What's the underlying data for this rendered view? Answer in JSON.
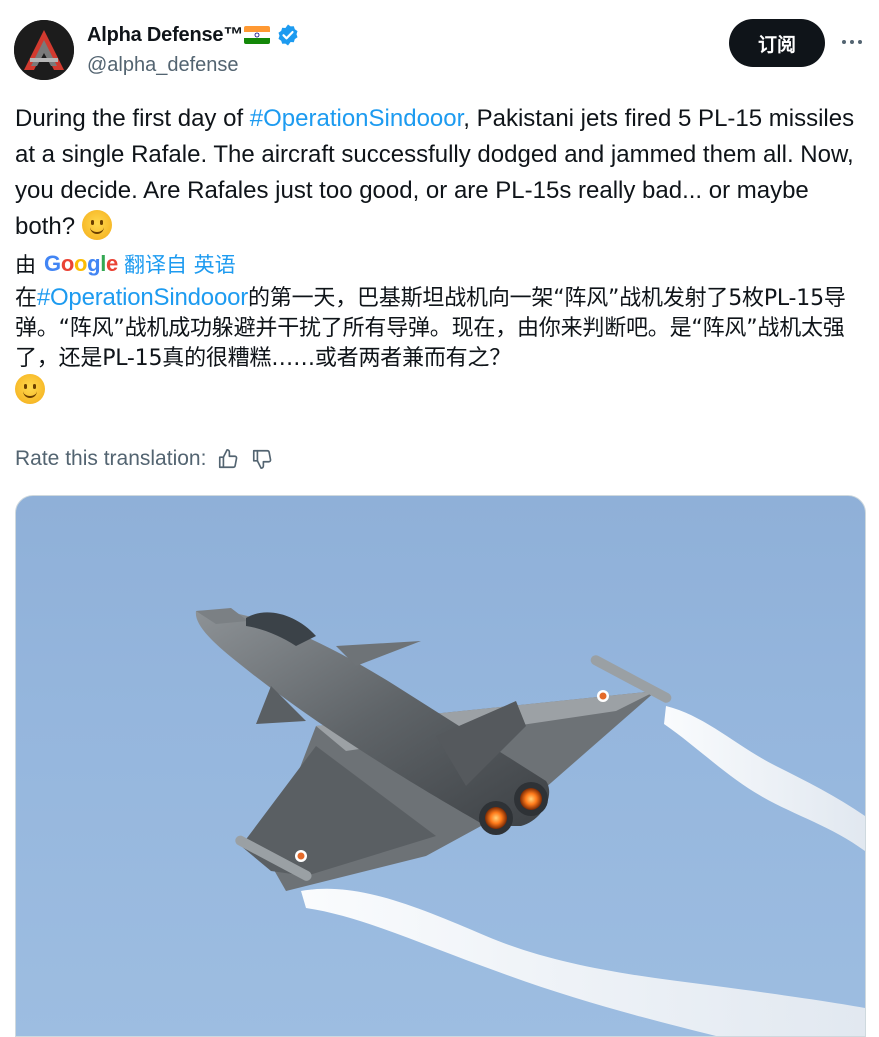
{
  "author": {
    "display_name": "Alpha Defense™",
    "handle": "@alpha_defense"
  },
  "actions": {
    "subscribe_label": "订阅"
  },
  "tweet": {
    "text_before": "During the first day of ",
    "hashtag": "#OperationSindooor",
    "text_after": ", Pakistani jets fired 5 PL-15 missiles at a single Rafale. The aircraft successfully dodged and jammed them all. Now, you decide. Are Rafales just too good, or are PL-15s really bad... or maybe both? "
  },
  "translation": {
    "by_label": "由",
    "provider": "Google",
    "translated_from_label": "翻译自 英语",
    "text_before": "在",
    "hashtag": "#OperationSindooor",
    "text_after": "的第一天，巴基斯坦战机向一架“阵风”战机发射了5枚PL-15导弹。“阵风”战机成功躲避并干扰了所有导弹。现在，由你来判断吧。是“阵风”战机太强了，还是PL-15真的很糟糕……或者两者兼而有之？",
    "rate_label": "Rate this translation:"
  },
  "icons": {
    "verified": "verified-badge-icon",
    "more": "more-options-icon",
    "thumbs_up": "thumbs-up-icon",
    "thumbs_down": "thumbs-down-icon",
    "emoji": "slightly-smiling-face-emoji"
  },
  "colors": {
    "link": "#1d9bf0",
    "text": "#0f1419",
    "secondary": "#536471",
    "button_bg": "#0f1419"
  }
}
